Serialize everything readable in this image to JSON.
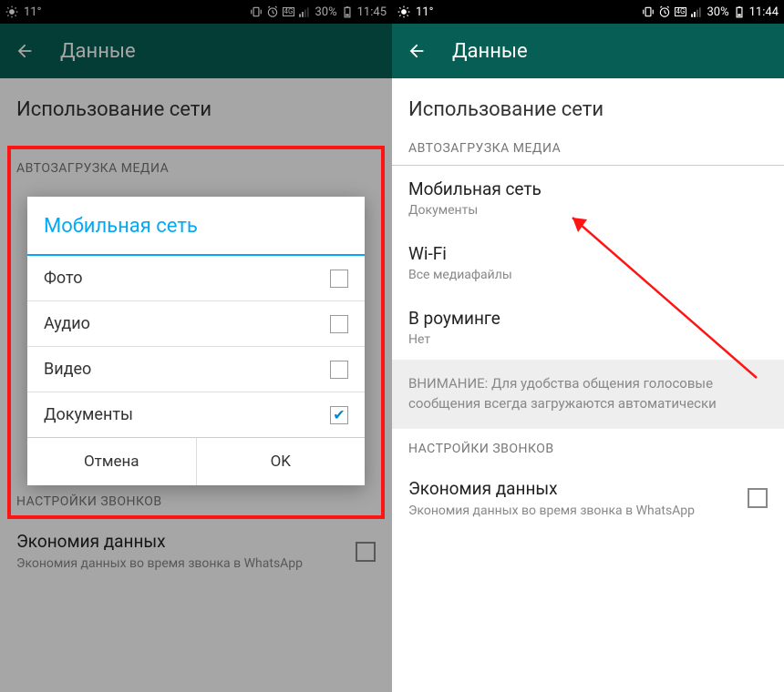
{
  "left": {
    "statusbar": {
      "temp": "11°",
      "battery_pct": "30%",
      "time": "11:45"
    },
    "toolbar": {
      "title": "Данные"
    },
    "heading": "Использование сети",
    "section_autoload": "АВТОЗАГРУЗКА МЕДИА",
    "section_calls": "НАСТРОЙКИ ЗВОНКОВ",
    "data_save": {
      "title": "Экономия данных",
      "sub": "Экономия данных во время звонка в WhatsApp"
    },
    "dialog": {
      "title": "Мобильная сеть",
      "items": [
        {
          "label": "Фото",
          "checked": false
        },
        {
          "label": "Аудио",
          "checked": false
        },
        {
          "label": "Видео",
          "checked": false
        },
        {
          "label": "Документы",
          "checked": true
        }
      ],
      "cancel": "Отмена",
      "ok": "OK"
    }
  },
  "right": {
    "statusbar": {
      "temp": "11°",
      "battery_pct": "30%",
      "time": "11:44"
    },
    "toolbar": {
      "title": "Данные"
    },
    "heading": "Использование сети",
    "section_autoload": "АВТОЗАГРУЗКА МЕДИА",
    "settings": [
      {
        "title": "Мобильная сеть",
        "sub": "Документы"
      },
      {
        "title": "Wi-Fi",
        "sub": "Все медиафайлы"
      },
      {
        "title": "В роуминге",
        "sub": "Нет"
      }
    ],
    "notice": "ВНИМАНИЕ: Для удобства общения голосовые сообщения всегда загружаются автоматически",
    "section_calls": "НАСТРОЙКИ ЗВОНКОВ",
    "data_save": {
      "title": "Экономия данных",
      "sub": "Экономия данных во время звонка в WhatsApp"
    }
  }
}
